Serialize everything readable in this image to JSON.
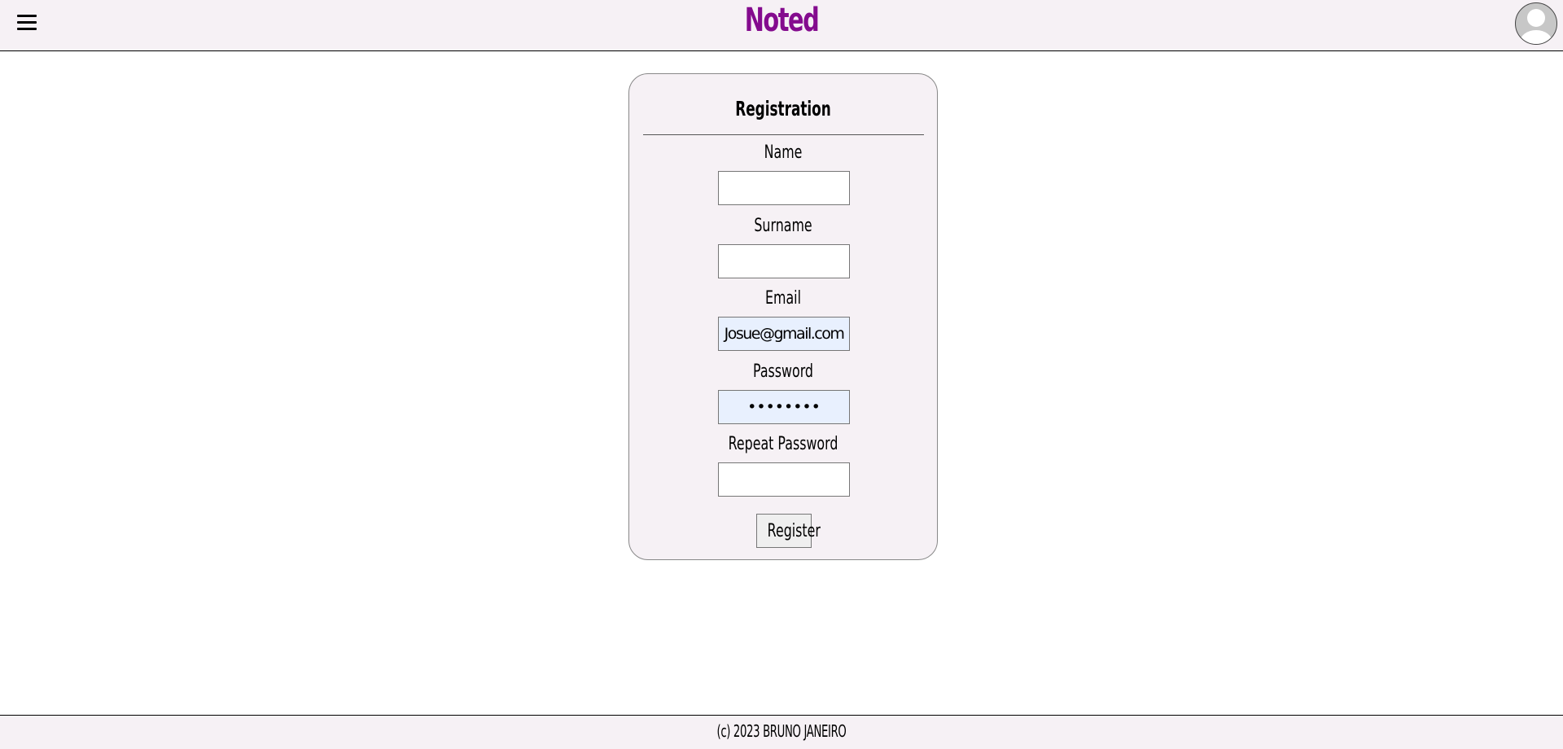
{
  "header": {
    "title": "Noted",
    "menu_icon": "hamburger-menu-icon",
    "avatar_icon": "user-avatar-icon"
  },
  "form": {
    "title": "Registration",
    "fields": [
      {
        "label": "Name",
        "value": "",
        "placeholder": ""
      },
      {
        "label": "Surname",
        "value": "",
        "placeholder": ""
      },
      {
        "label": "Email",
        "value": "Josue@gmail.com",
        "placeholder": ""
      },
      {
        "label": "Password",
        "value": "••••••••",
        "placeholder": ""
      },
      {
        "label": "Repeat Password",
        "value": "",
        "placeholder": ""
      }
    ],
    "submit_label": "Register"
  },
  "footer": {
    "text": "(c) 2023 BRUNO JANEIRO"
  },
  "colors": {
    "brand": "#840b8e",
    "bar_background": "#f6f1f5",
    "autofill_background": "#e8f0fe"
  }
}
